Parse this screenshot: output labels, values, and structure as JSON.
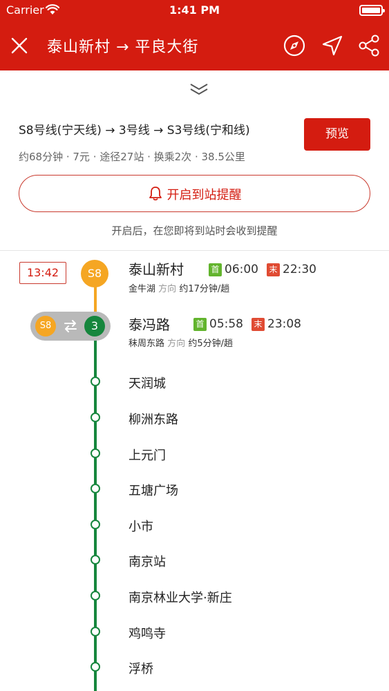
{
  "status_bar": {
    "carrier": "Carrier",
    "time": "1:41 PM"
  },
  "nav": {
    "title": "泰山新村 → 平良大街",
    "icons": [
      "close-icon",
      "compass-icon",
      "navigate-icon",
      "share-icon"
    ]
  },
  "route": {
    "summary": "S8号线(宁天线) → 3号线 → S3号线(宁和线)",
    "meta": "约68分钟 · 7元 · 途径27站 · 换乘2次 · 38.5公里",
    "preview_label": "预览"
  },
  "alert": {
    "button_label": "开启到站提醒",
    "hint": "开启后，在您即将到站时会收到提醒"
  },
  "timeline": {
    "depart_time": "13:42",
    "start": {
      "line_badge": "S8",
      "station": "泰山新村",
      "first_tag": "首",
      "first_time": "06:00",
      "last_tag": "末",
      "last_time": "22:30",
      "direction_station": "金牛湖",
      "direction_label": "方向",
      "frequency": "约17分钟/趟"
    },
    "transfer": {
      "from_line": "S8",
      "to_line": "3",
      "station": "泰冯路",
      "first_tag": "首",
      "first_time": "05:58",
      "last_tag": "末",
      "last_time": "23:08",
      "direction_station": "秣周东路",
      "direction_label": "方向",
      "frequency": "约5分钟/趟"
    },
    "stops": [
      "天润城",
      "柳洲东路",
      "上元门",
      "五塘广场",
      "小市",
      "南京站",
      "南京林业大学·新庄",
      "鸡鸣寺",
      "浮桥"
    ]
  },
  "colors": {
    "brand_red": "#d41c10",
    "line_s8": "#f5a623",
    "line_3": "#16863d",
    "first_tag": "#62b42d",
    "last_tag": "#e04b33"
  }
}
